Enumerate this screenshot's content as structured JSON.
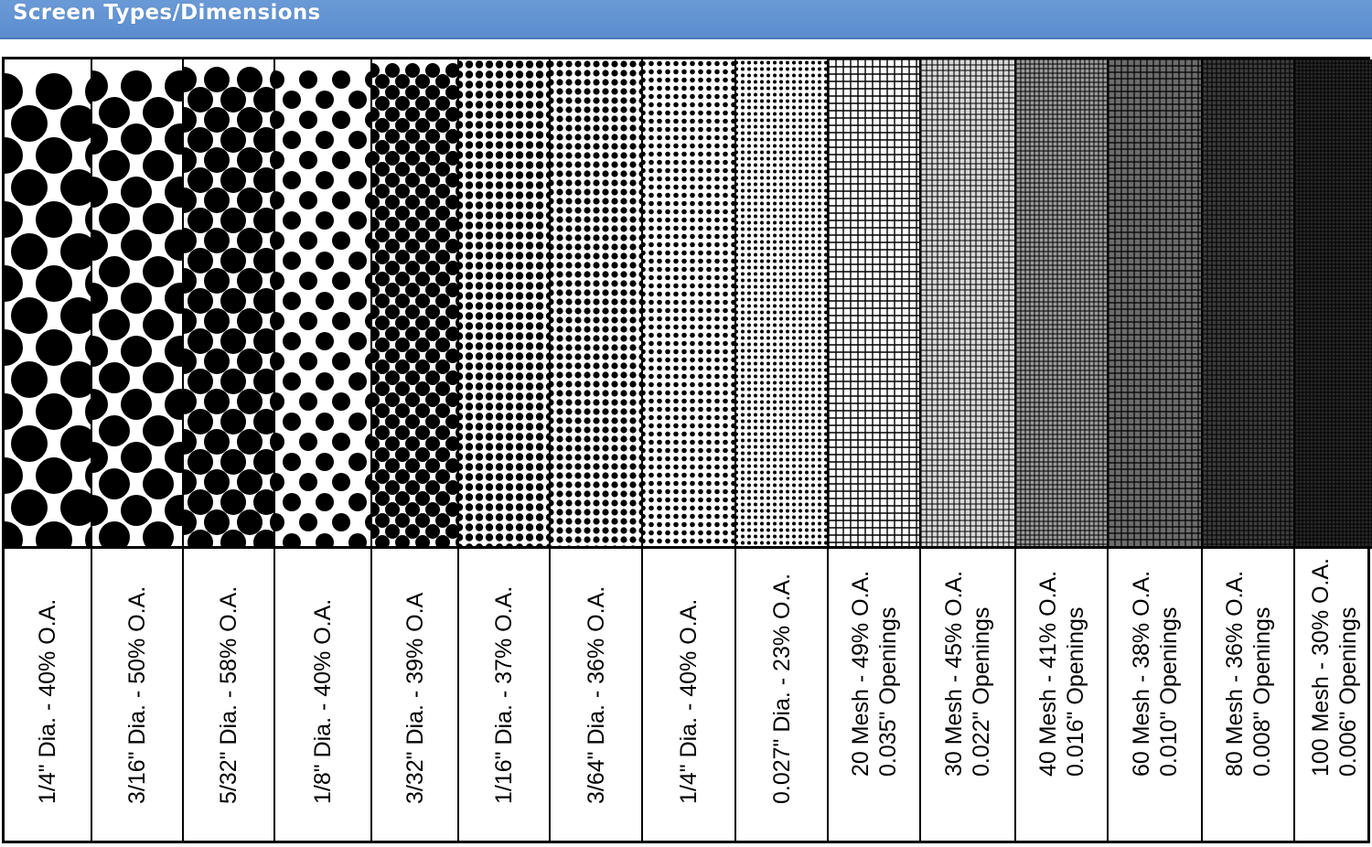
{
  "header": {
    "title": "Screen Types/Dimensions"
  },
  "screens": [
    {
      "label1": "1/4\" Dia. - 40% O.A.",
      "label2": "",
      "pattern": "dots-large"
    },
    {
      "label1": "3/16\" Dia. - 50% O.A.",
      "label2": "",
      "pattern": "dots"
    },
    {
      "label1": "5/32\" Dia. - 58% O.A.",
      "label2": "",
      "pattern": "dots"
    },
    {
      "label1": "1/8\" Dia. - 40% O.A.",
      "label2": "",
      "pattern": "dots"
    },
    {
      "label1": "3/32\" Dia. - 39% O.A",
      "label2": "",
      "pattern": "dots"
    },
    {
      "label1": "1/16\" Dia. - 37% O.A.",
      "label2": "",
      "pattern": "dots"
    },
    {
      "label1": "3/64\" Dia. - 36% O.A.",
      "label2": "",
      "pattern": "dots"
    },
    {
      "label1": "1/4\" Dia. - 40% O.A.",
      "label2": "",
      "pattern": "dots"
    },
    {
      "label1": "0.027\" Dia. - 23% O.A.",
      "label2": "",
      "pattern": "dots"
    },
    {
      "label1": "20 Mesh - 49% O.A.",
      "label2": "0.035\" Openings",
      "pattern": "mesh"
    },
    {
      "label1": "30 Mesh - 45% O.A.",
      "label2": "0.022\" Openings",
      "pattern": "mesh"
    },
    {
      "label1": "40 Mesh - 41% O.A.",
      "label2": "0.016\" Openings",
      "pattern": "mesh"
    },
    {
      "label1": "60 Mesh - 38% O.A.",
      "label2": "0.010\" Openings",
      "pattern": "mesh"
    },
    {
      "label1": "80 Mesh - 36% O.A.",
      "label2": "0.008\" Openings",
      "pattern": "mesh"
    },
    {
      "label1": "100 Mesh - 30% O.A.",
      "label2": "0.006\" Openings",
      "pattern": "mesh"
    }
  ]
}
